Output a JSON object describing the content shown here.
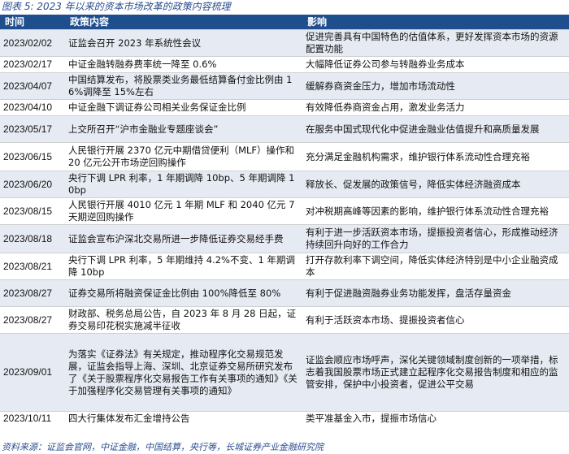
{
  "caption": "图表 5: 2023 年以来的资本市场改革的政策内容梳理",
  "headers": [
    "时间",
    "政策内容",
    "影响"
  ],
  "rows": [
    {
      "date": "2023/02/02",
      "policy": "证监会召开 2023 年系统性会议",
      "impact": "促进完善具有中国特色的估值体系，更好发挥资本市场的资源配置功能"
    },
    {
      "date": "2023/02/17",
      "policy": "中证金融转融券费率统一降至 0.6%",
      "impact": "大幅降低证券公司参与转融券业务成本"
    },
    {
      "date": "2023/04/07",
      "policy": "中国结算发布，将股票类业务最低结算备付金比例由 16%调降至 15%左右",
      "impact": "缓解券商资金压力，增加市场流动性"
    },
    {
      "date": "2023/04/10",
      "policy": "中证金融下调证券公司相关业务保证金比例",
      "impact": "有效降低券商资金占用，激发业务活力"
    },
    {
      "date": "2023/05/17",
      "policy": "上交所召开“沪市金融业专题座谈会”",
      "impact": "在服务中国式现代化中促进金融业估值提升和高质量发展"
    },
    {
      "date": "2023/06/15",
      "policy": "人民银行开展 2370 亿元中期借贷便利（MLF）操作和 20 亿元公开市场逆回购操作",
      "impact": "充分满足金融机构需求，维护银行体系流动性合理充裕"
    },
    {
      "date": "2023/06/20",
      "policy": "央行下调 LPR 利率，1 年期调降 10bp、5 年期调降 10bp",
      "impact": "释放长、促发展的政策信号，降低实体经济融资成本"
    },
    {
      "date": "2023/08/15",
      "policy": "人民银行开展 4010 亿元 1 年期 MLF 和 2040 亿元 7 天期逆回购操作",
      "impact": "对冲税期高峰等因素的影响，维护银行体系流动性合理充裕"
    },
    {
      "date": "2023/08/18",
      "policy": "证监会宣布沪深北交易所进一步降低证券交易经手费",
      "impact": "有利于进一步活跃资本市场，提振投资者信心，形成推动经济持续回升向好的工作合力"
    },
    {
      "date": "2023/08/21",
      "policy": "央行下调 LPR 利率，5 年期维持 4.2%不变、1 年期调降 10bp",
      "impact": "打开存款利率下调空间，降低实体经济特别是中小企业融资成本"
    },
    {
      "date": "2023/08/27",
      "policy": "证券交易所将融资保证金比例由 100%降低至 80%",
      "impact": "有利于促进融资融券业务功能发挥，盘活存量资金"
    },
    {
      "date": "2023/08/27",
      "policy": "财政部、税务总局公告，自 2023 年 8 月 28 日起，证券交易印花税实施减半征收",
      "impact": "有利于活跃资本市场、提振投资者信心"
    },
    {
      "date": "2023/09/01",
      "policy": "为落实《证券法》有关规定，推动程序化交易规范发展，证监会指导上海、深圳、北京证券交易所研究发布了《关于股票程序化交易报告工作有关事项的通知》《关于加强程序化交易管理有关事项的通知》",
      "impact": "证监会顺应市场呼声，深化关键领域制度创新的一项举措，标志着我国股票市场正式建立起程序化交易报告制度和相应的监管安排，保护中小投资者，促进公平交易"
    },
    {
      "date": "2023/10/11",
      "policy": "四大行集体发布汇金增持公告",
      "impact": "类平准基金入市，提振市场信心"
    }
  ],
  "source": "资料来源：证监会官网，中证金融，中国结算，央行等，长城证券产业金融研究院"
}
